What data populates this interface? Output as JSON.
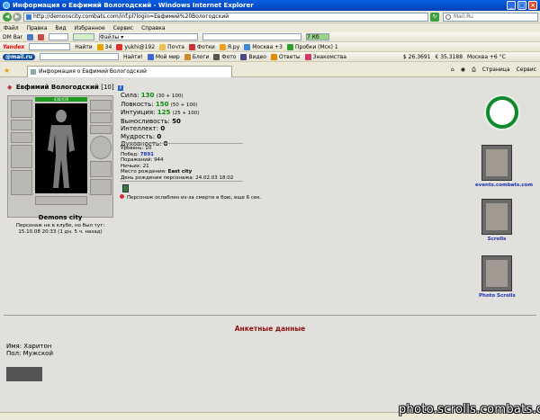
{
  "window": {
    "title": "Информация о Евфимий Вологодский - Windows Internet Explorer"
  },
  "address": {
    "url": "http://demonscity.combats.com/inf.pl?login=Евфимий%20Вологодский",
    "search_placeholder": "Mail.Ru"
  },
  "menu": [
    "Файл",
    "Правка",
    "Вид",
    "Избранное",
    "Сервис",
    "Справка"
  ],
  "toolbar1": {
    "label": "DM Bar",
    "files_label": "Файлы",
    "badge": "7 Кб"
  },
  "toolbar2": {
    "logo": "Yandex",
    "find": "Найти",
    "count": "34",
    "user": "yukhi@192",
    "mail": "Почта",
    "photo": "Фотки",
    "yaru": "Я.ру",
    "weather": "Москва +3",
    "traffic": "Пробки (Мск) 1"
  },
  "toolbar3": {
    "logo": "@mail.ru",
    "find": "Найти!",
    "items": [
      "Мой мир",
      "Блоги",
      "Фото",
      "Видео",
      "Ответы",
      "Знакомства"
    ],
    "usd": "$ 26.3691",
    "eur": "€ 35.3188",
    "weather": "Москва +6 °C"
  },
  "tab": {
    "title": "Информация о Евфимий Вологодский"
  },
  "tab_tools": {
    "page": "Страница",
    "service": "Сервис"
  },
  "character": {
    "name": "Евфимий Вологодский",
    "level": "[10]",
    "hp": "430/430",
    "city": "Demons city",
    "presence_line1": "Персонаж не в клубе, но был тут:",
    "presence_line2": "15.10.08 20:33 (1 дн. 5 ч. назад)"
  },
  "stats": {
    "strength": {
      "label": "Сила:",
      "value": "130",
      "extra": "(30 + 100)"
    },
    "agility": {
      "label": "Ловкость:",
      "value": "150",
      "extra": "(50 + 100)"
    },
    "intuition": {
      "label": "Интуиция:",
      "value": "125",
      "extra": "(25 + 100)"
    },
    "endurance": {
      "label": "Выносливость:",
      "value": "50"
    },
    "intellect": {
      "label": "Интеллект:",
      "value": "0"
    },
    "wisdom": {
      "label": "Мудрость:",
      "value": "0"
    },
    "spirit": {
      "label": "Духовность:",
      "value": "0"
    }
  },
  "details": {
    "level": {
      "label": "Уровень:",
      "value": "10"
    },
    "wins": {
      "label": "Побед:",
      "value": "7891"
    },
    "losses": {
      "label": "Поражений:",
      "value": "944"
    },
    "draws": {
      "label": "Ничьих:",
      "value": "21"
    },
    "birthplace": {
      "label": "Место рождения:",
      "value": "East city"
    },
    "birthday": {
      "label": "День рождения персонажа:",
      "value": "24.02.03 18:02"
    }
  },
  "effect": {
    "text": "Персонаж ослаблен из-за смерти в бою, еще 6 сек."
  },
  "sidebar": {
    "events": "events.combats.com",
    "scrolls": "Scrolls",
    "photo_scrolls": "Photo Scrolls"
  },
  "anketa": {
    "title": "Анкетные данные",
    "name": "Имя: Харитон",
    "sex": "Пол: Мужской"
  },
  "watermark": "photo.scrolls.combats.com",
  "colors": {
    "stat_value": "#0a8a0a",
    "anketa_title": "#8a1010",
    "link": "#1a2fb0",
    "hp_bar": "#1f9a1f"
  }
}
